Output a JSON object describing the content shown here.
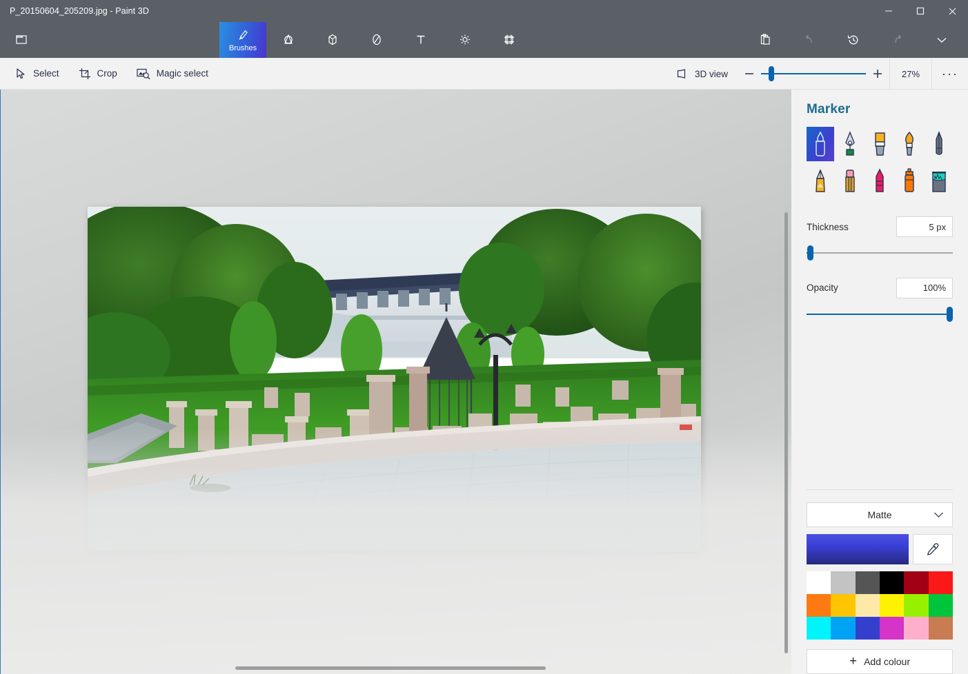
{
  "window": {
    "title": "P_20150604_205209.jpg  -  Paint 3D",
    "minimize_label": "minimize",
    "maximize_label": "maximize",
    "close_label": "close"
  },
  "ribbon": {
    "items": [
      {
        "id": "menu",
        "icon": "folder-icon",
        "label": ""
      },
      {
        "id": "brushes",
        "icon": "brush-icon",
        "label": "Brushes"
      },
      {
        "id": "shapes2d",
        "icon": "2d-shapes-icon",
        "label": ""
      },
      {
        "id": "shapes3d",
        "icon": "3d-shapes-icon",
        "label": ""
      },
      {
        "id": "stickers",
        "icon": "stickers-icon",
        "label": ""
      },
      {
        "id": "text",
        "icon": "text-icon",
        "label": ""
      },
      {
        "id": "effects",
        "icon": "effects-icon",
        "label": ""
      },
      {
        "id": "canvas",
        "icon": "canvas-icon",
        "label": ""
      }
    ],
    "right_items": [
      {
        "id": "clipboard",
        "icon": "clipboard-icon",
        "disabled": false
      },
      {
        "id": "undo",
        "icon": "undo-icon",
        "disabled": true
      },
      {
        "id": "history",
        "icon": "history-icon",
        "disabled": false
      },
      {
        "id": "redo",
        "icon": "redo-icon",
        "disabled": true
      },
      {
        "id": "expand",
        "icon": "chevron-down-icon",
        "disabled": false
      }
    ]
  },
  "subbar": {
    "select_label": "Select",
    "crop_label": "Crop",
    "magic_select_label": "Magic select",
    "view3d_label": "3D view",
    "zoom_out_label": "−",
    "zoom_in_label": "+",
    "zoom_value": "27%",
    "more_label": "···"
  },
  "panel": {
    "title": "Marker",
    "brushes": [
      {
        "id": "marker",
        "name": "marker-brush",
        "selected": true
      },
      {
        "id": "calligraphy-pen",
        "name": "calligraphy-pen-brush",
        "selected": false
      },
      {
        "id": "oil-brush",
        "name": "oil-brush",
        "selected": false
      },
      {
        "id": "watercolour",
        "name": "watercolour-brush",
        "selected": false
      },
      {
        "id": "pixel-pen",
        "name": "pixel-pen-brush",
        "selected": false
      },
      {
        "id": "pencil",
        "name": "pencil-brush",
        "selected": false
      },
      {
        "id": "eraser",
        "name": "eraser-brush",
        "selected": false
      },
      {
        "id": "crayon",
        "name": "crayon-brush",
        "selected": false
      },
      {
        "id": "spray-can",
        "name": "spray-can-brush",
        "selected": false
      },
      {
        "id": "fill",
        "name": "fill-brush",
        "selected": false
      }
    ],
    "thickness_label": "Thickness",
    "thickness_value": "5 px",
    "thickness_percent": 4,
    "opacity_label": "Opacity",
    "opacity_value": "100%",
    "opacity_percent": 100,
    "material_label": "Matte",
    "current_colour": "#3a3fd6",
    "eyedropper_label": "eyedropper",
    "add_colour_label": "Add colour",
    "add_colour_plus": "+",
    "swatches": [
      {
        "name": "white",
        "hex": "#ffffff"
      },
      {
        "name": "light-grey",
        "hex": "#c3c3c3"
      },
      {
        "name": "dark-grey",
        "hex": "#555555"
      },
      {
        "name": "black",
        "hex": "#000000"
      },
      {
        "name": "dark-red",
        "hex": "#a20014"
      },
      {
        "name": "red",
        "hex": "#fa1919"
      },
      {
        "name": "orange",
        "hex": "#fd7a12"
      },
      {
        "name": "amber",
        "hex": "#ffc500"
      },
      {
        "name": "cream",
        "hex": "#ffe9a8"
      },
      {
        "name": "yellow",
        "hex": "#fff200"
      },
      {
        "name": "chartreuse",
        "hex": "#96f000"
      },
      {
        "name": "green",
        "hex": "#00c53c"
      },
      {
        "name": "cyan",
        "hex": "#00f5fb"
      },
      {
        "name": "sky-blue",
        "hex": "#00a2f5"
      },
      {
        "name": "indigo",
        "hex": "#3440cd"
      },
      {
        "name": "magenta",
        "hex": "#d434c8"
      },
      {
        "name": "pink",
        "hex": "#ffafcb"
      },
      {
        "name": "brown",
        "hex": "#c97b51"
      }
    ]
  },
  "canvas": {
    "image_alt": "Photo of a monastery courtyard with carved stone fragments on a lawn, tall trees, a white two-storey wall building with dark roof, a dark conical pavilion, a street lamp and a paved plaza with a curved low wall"
  }
}
